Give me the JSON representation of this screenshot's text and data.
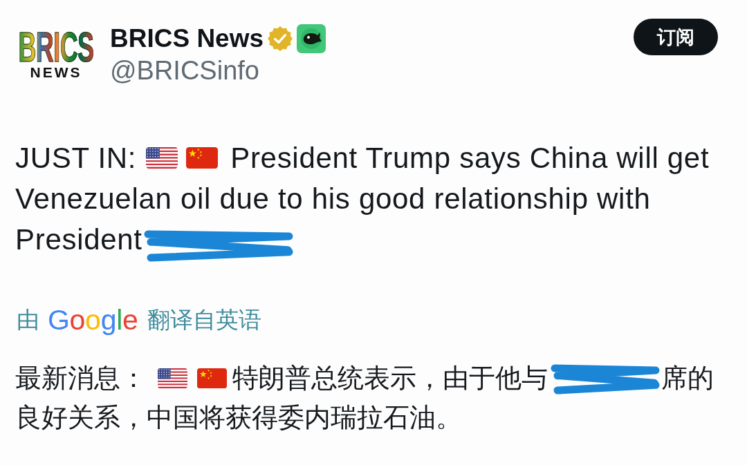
{
  "header": {
    "logo": {
      "wordmark": "BRICS",
      "subtitle": "NEWS"
    },
    "name": "BRICS News",
    "verified": true,
    "handle": "@BRICSinfo",
    "subscribe_button": "订阅"
  },
  "post": {
    "label": "JUST IN:",
    "flags": [
      {
        "kind": "us"
      },
      {
        "kind": "china"
      }
    ],
    "lines": [
      "President Trump says China will get",
      "Venezuelan oil due to his good relationship with",
      "President"
    ],
    "redacted": true
  },
  "translation_note": {
    "prefix": "由",
    "brand": "Google",
    "suffix": "翻译自英语"
  },
  "translation": {
    "label": "最新消息：",
    "flags": [
      {
        "kind": "us"
      },
      {
        "kind": "china"
      }
    ],
    "text_before": "特朗普总统表示，由于他与",
    "redacted": true,
    "text_after": "席的",
    "continuation": "良好关系，中国将获得委内瑞拉石油。"
  }
}
